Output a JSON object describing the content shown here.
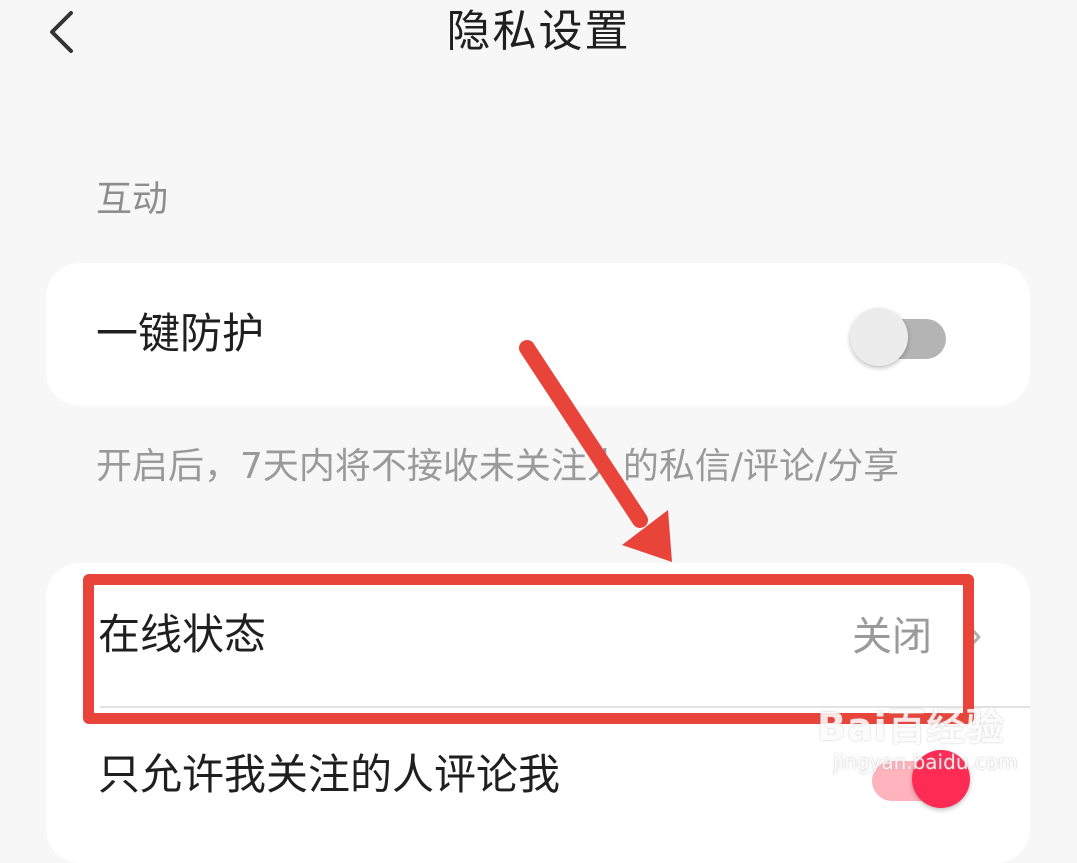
{
  "header": {
    "title": "隐私设置",
    "back_icon": "chevron-left-icon"
  },
  "section": {
    "title": "互动"
  },
  "one_key_protect": {
    "label": "一键防护",
    "enabled": false,
    "description": "开启后，7天内将不接收未关注人的私信/评论/分享"
  },
  "online_status": {
    "label": "在线状态",
    "value": "关闭",
    "chevron_icon": "chevron-right-icon"
  },
  "comment_setting": {
    "label": "只允许我关注的人评论我",
    "enabled": true
  },
  "colors": {
    "background": "#f7f7f7",
    "card": "#ffffff",
    "toggle_off_track": "#b4b4b4",
    "toggle_on_knob": "#fe2c55",
    "annotation": "#e8443a"
  },
  "watermark": {
    "logo": "Bai百经验",
    "domain": "jingyan.baidu.com"
  }
}
